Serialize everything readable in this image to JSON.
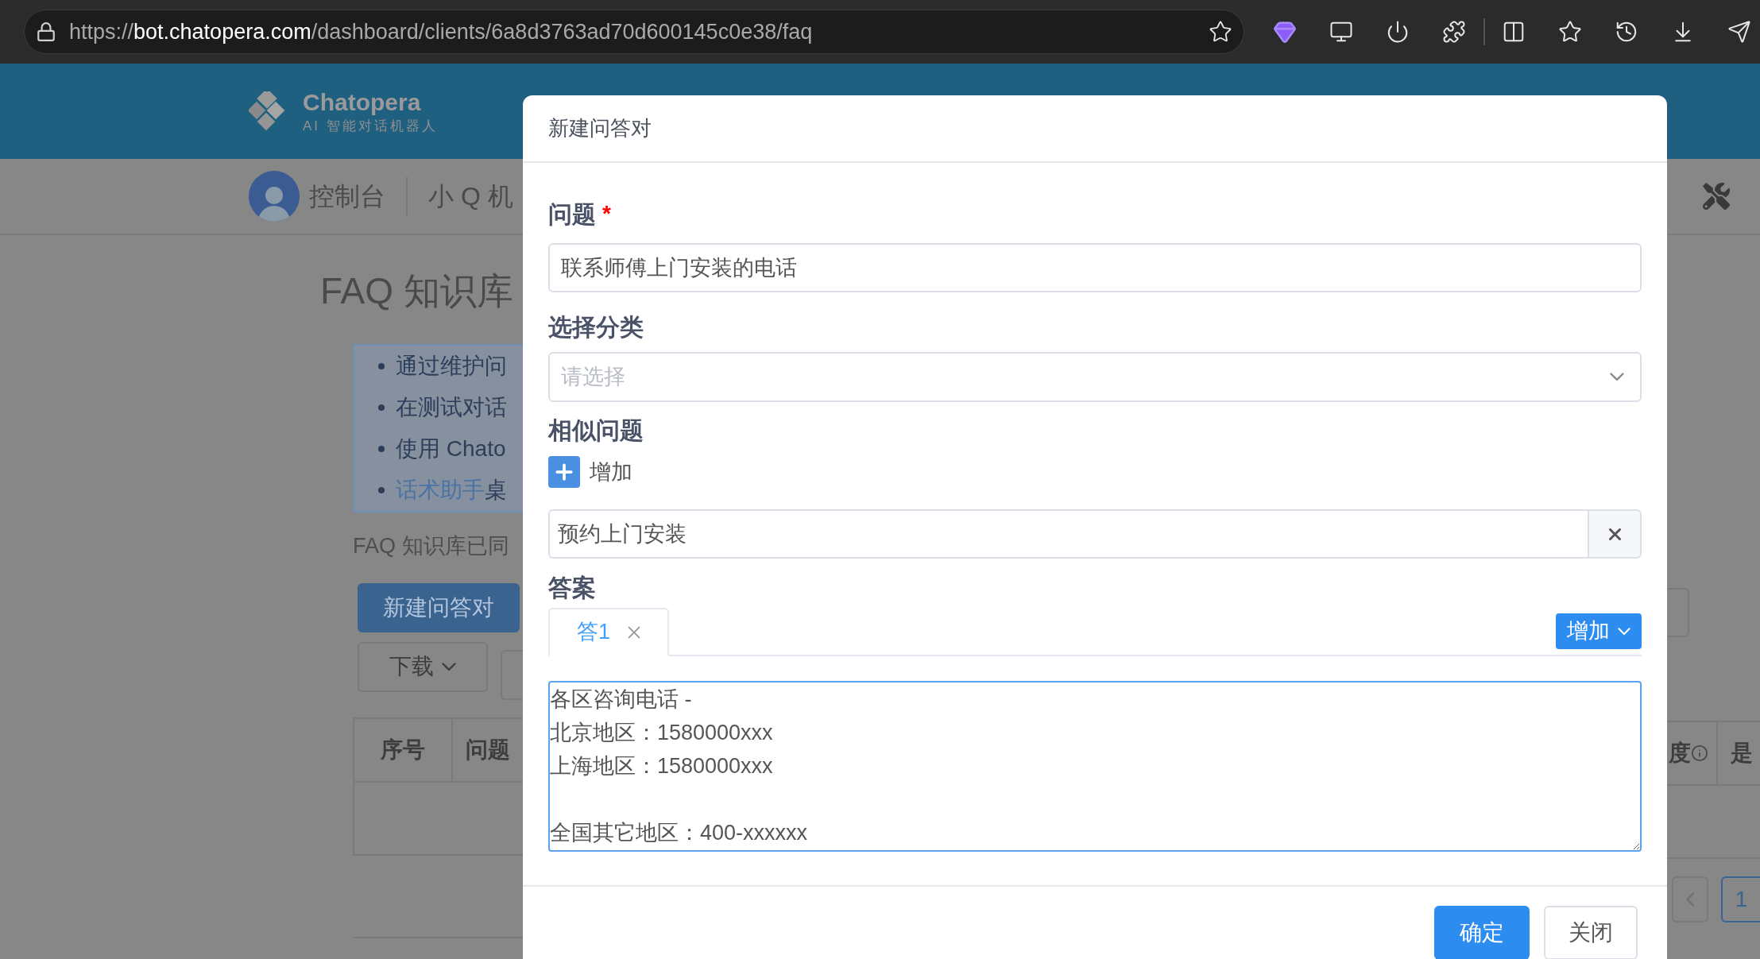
{
  "browser": {
    "url": {
      "scheme": "https://",
      "host": "bot.chatopera.com",
      "path": "/dashboard/clients/6a8d3763ad70d600145c0e38/faq"
    }
  },
  "header": {
    "brand": "Chatopera",
    "tagline": "AI 智能对话机器人"
  },
  "nav": {
    "items": [
      "控制台",
      "小 Q 机"
    ]
  },
  "page": {
    "title": "FAQ 知识库",
    "tips": [
      {
        "kind": "text",
        "text": "通过维护问"
      },
      {
        "kind": "text",
        "text": "在测试对话"
      },
      {
        "kind": "text",
        "text": "使用 Chato"
      },
      {
        "kind": "link",
        "link": "话术助手",
        "text": "桌"
      }
    ],
    "sync_note": "FAQ 知识库已同",
    "create_button": "新建问答对",
    "download_button": "下载",
    "table": {
      "columns": [
        "序号",
        "问题"
      ],
      "right_columns": [
        "度",
        "是"
      ]
    },
    "pagination": [
      {
        "label": "1",
        "selected": true
      }
    ]
  },
  "modal": {
    "title": "新建问答对",
    "question": {
      "label": "问题",
      "required": true,
      "required_mark": "*",
      "value": "联系师傅上门安装的电话"
    },
    "category": {
      "label": "选择分类",
      "placeholder": "请选择"
    },
    "similar": {
      "label": "相似问题",
      "add_label": "增加",
      "items": [
        "预约上门安装"
      ]
    },
    "answer": {
      "label": "答案",
      "tabs": [
        {
          "label": "答1",
          "selected": true
        }
      ],
      "add_label": "增加",
      "text": "各区咨询电话 -\n北京地区：1580000xxx\n上海地区：1580000xxx\n\n全国其它地区：400-xxxxxx"
    },
    "confirm": "确定",
    "close": "关闭"
  }
}
